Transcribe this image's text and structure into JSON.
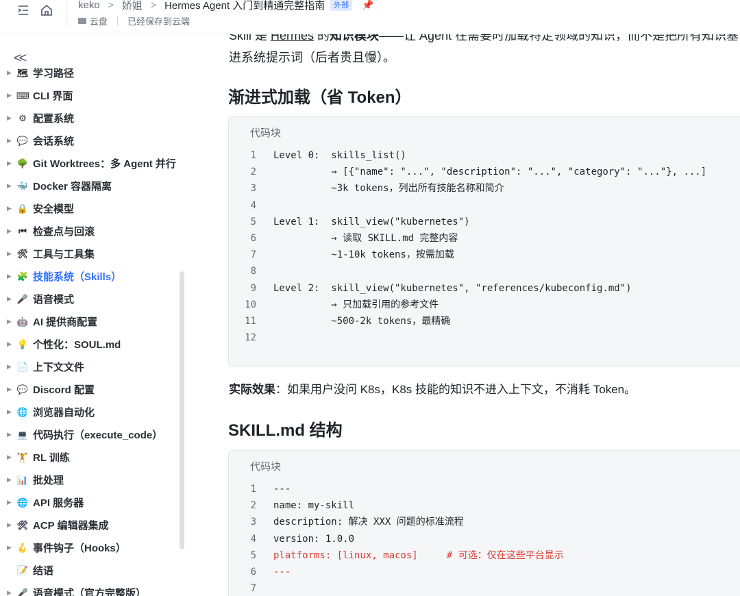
{
  "header": {
    "breadcrumbs": [
      "keko",
      "娇姐"
    ],
    "doc_title": "Hermes Agent 入门到精通完整指南",
    "badge": "外部",
    "location": "云盘",
    "save_status": "已经保存到云端"
  },
  "sidebar": {
    "items": [
      {
        "emoji": "🗺",
        "label": "学习路径"
      },
      {
        "emoji": "⌨",
        "label": "CLI 界面"
      },
      {
        "emoji": "⚙",
        "label": "配置系统"
      },
      {
        "emoji": "💬",
        "label": "会话系统"
      },
      {
        "emoji": "🌳",
        "label": "Git Worktrees：多 Agent 并行"
      },
      {
        "emoji": "🐳",
        "label": "Docker 容器隔离"
      },
      {
        "emoji": "🔒",
        "label": "安全模型"
      },
      {
        "emoji": "⏮",
        "label": "检查点与回滚"
      },
      {
        "emoji": "🛠",
        "label": "工具与工具集"
      },
      {
        "emoji": "🧩",
        "label": "技能系统（Skills）",
        "active": true
      },
      {
        "emoji": "🎤",
        "label": "语音模式"
      },
      {
        "emoji": "🤖",
        "label": "AI 提供商配置"
      },
      {
        "emoji": "💡",
        "label": "个性化：SOUL.md"
      },
      {
        "emoji": "📄",
        "label": "上下文文件"
      },
      {
        "emoji": "💬",
        "label": "Discord 配置"
      },
      {
        "emoji": "🌐",
        "label": "浏览器自动化"
      },
      {
        "emoji": "💻",
        "label": "代码执行（execute_code）"
      },
      {
        "emoji": "🏋",
        "label": "RL 训练"
      },
      {
        "emoji": "📊",
        "label": "批处理"
      },
      {
        "emoji": "🌐",
        "label": "API 服务器"
      },
      {
        "emoji": "🛠",
        "label": "ACP 编辑器集成"
      },
      {
        "emoji": "🪝",
        "label": "事件钩子（Hooks）"
      },
      {
        "emoji": "📝",
        "label": "结语",
        "no_arrow": true
      },
      {
        "emoji": "🎤",
        "label": "语音模式（官方完整版）"
      }
    ]
  },
  "content": {
    "intro": {
      "a": "Skill 是 ",
      "b": "Hermes",
      "c": " 的",
      "d": "知识模块",
      "e": "——让 Agent 在需要时加载特定领域的知识，而不是把所有知识塞进系统提示词（后者贵且慢）。"
    },
    "h_progressive": "渐进式加载（省 Token）",
    "code1": {
      "title": "代码块",
      "lines": [
        "Level 0:  skills_list()",
        "          → [{\"name\": \"...\", \"description\": \"...\", \"category\": \"...\"}, ...]",
        "          ~3k tokens，列出所有技能名称和简介",
        "",
        "Level 1:  skill_view(\"kubernetes\")",
        "          → 读取 SKILL.md 完整内容",
        "          ~1-10k tokens，按需加载",
        "",
        "Level 2:  skill_view(\"kubernetes\", \"references/kubeconfig.md\")",
        "          → 只加载引用的参考文件",
        "          ~500-2k tokens，最精确",
        ""
      ]
    },
    "effect": {
      "label": "实际效果",
      "text": "：如果用户没问 K8s，K8s 技能的知识不进入上下文，不消耗 Token。"
    },
    "h_structure": "SKILL.md 结构",
    "code2": {
      "title": "代码块",
      "lines": [
        {
          "t": "---"
        },
        {
          "t": "name: my-skill"
        },
        {
          "t": "description: 解决 XXX 问题的标准流程"
        },
        {
          "t": "version: 1.0.0"
        },
        {
          "t": "platforms: [linux, macos]     # 可选：仅在这些平台显示",
          "red": true
        },
        {
          "t": "---",
          "red": true
        },
        {
          "t": ""
        }
      ]
    }
  }
}
